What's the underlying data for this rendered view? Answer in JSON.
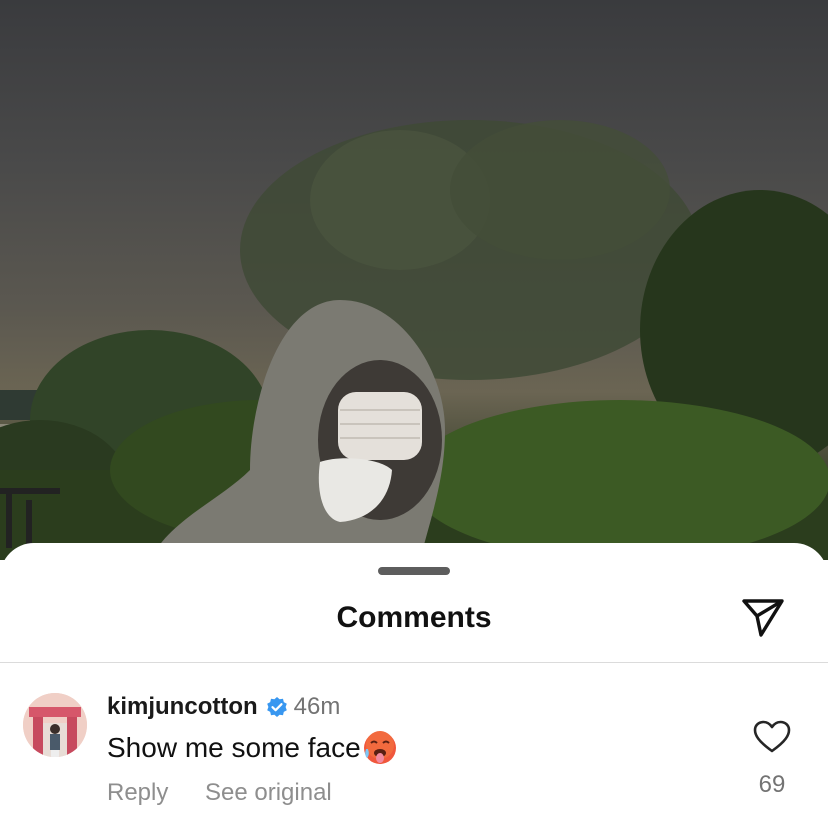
{
  "photo": {
    "description_icon": "post-photo"
  },
  "sheet": {
    "title": "Comments",
    "share_icon": "paper-plane-icon"
  },
  "comment": {
    "username": "kimjuncotton",
    "verified": true,
    "time": "46m",
    "text": "Show me some face",
    "emoji": "hot-face-emoji",
    "reply_label": "Reply",
    "see_original_label": "See original",
    "like_count": "69"
  },
  "colors": {
    "sheet_bg": "#ffffff",
    "text_primary": "#111111",
    "text_secondary": "#8e8e8e",
    "verified_blue": "#3897f0",
    "divider": "#dbdbdb"
  }
}
